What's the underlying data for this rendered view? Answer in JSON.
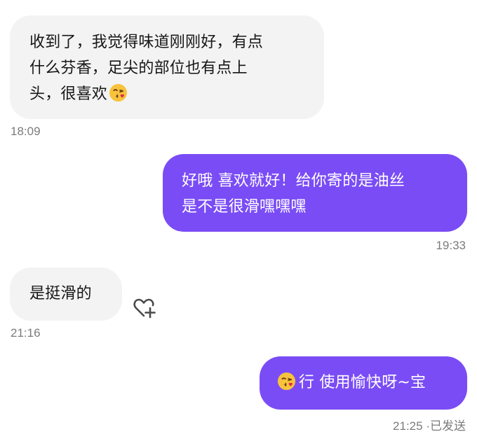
{
  "messages": [
    {
      "side": "incoming",
      "lines": [
        "收到了，我觉得味道刚刚好，有点",
        "什么芬香，足尖的部位也有点上",
        "头，很喜欢"
      ],
      "emoji": "kissing-heart-emoji",
      "time": "18:09"
    },
    {
      "side": "outgoing",
      "lines": [
        "好哦 喜欢就好！给你寄的是油丝",
        "是不是很滑嘿嘿嘿"
      ],
      "time": "19:33"
    },
    {
      "side": "incoming",
      "lines": [
        "是挺滑的"
      ],
      "time": "21:16",
      "reaction_icon": "heart-plus-icon"
    },
    {
      "side": "outgoing",
      "emoji": "kissing-heart-emoji",
      "lines": [
        "行 使用愉快呀~宝"
      ],
      "time": "21:25",
      "status": "已发送"
    }
  ],
  "colors": {
    "incoming_bubble": "#f3f3f3",
    "outgoing_bubble": "#7a4cf5",
    "timestamp": "#7b7b7b"
  }
}
